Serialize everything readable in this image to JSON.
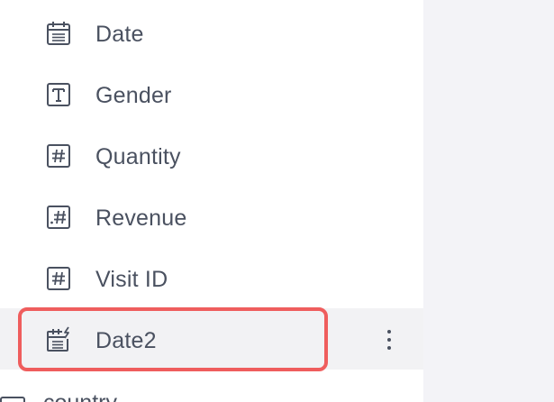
{
  "fields": [
    {
      "label": "Date",
      "icon": "calendar-icon"
    },
    {
      "label": "Gender",
      "icon": "text-type-icon"
    },
    {
      "label": "Quantity",
      "icon": "number-type-icon"
    },
    {
      "label": "Revenue",
      "icon": "decimal-number-type-icon"
    },
    {
      "label": "Visit ID",
      "icon": "number-type-icon"
    },
    {
      "label": "Date2",
      "icon": "calculated-date-icon"
    }
  ],
  "next_table": {
    "label": "country",
    "icon": "table-icon"
  },
  "colors": {
    "panel_bg": "#ffffff",
    "right_bg": "#f3f3f7",
    "selected_row_bg": "#f2f2f4",
    "highlight_border": "#ef5d5d",
    "text": "#4a5160",
    "icon_stroke": "#4a5160"
  }
}
